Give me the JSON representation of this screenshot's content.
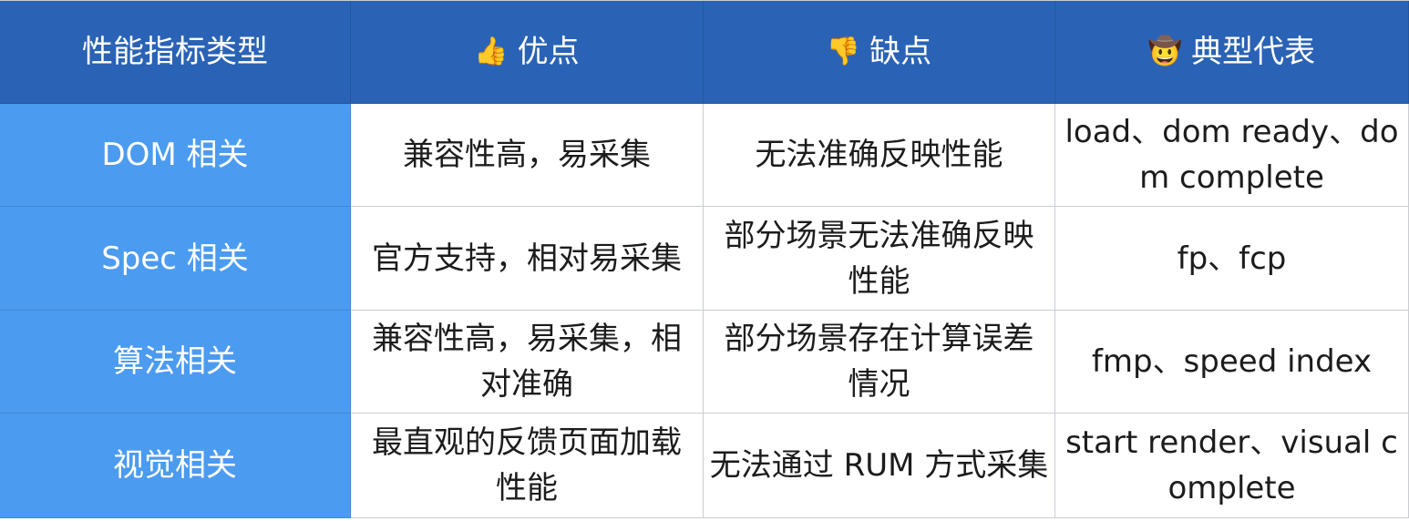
{
  "header": {
    "col1": "性能指标类型",
    "col2": {
      "icon": "👍",
      "label": "优点"
    },
    "col3": {
      "icon": "👎",
      "label": "缺点"
    },
    "col4": {
      "icon": "🤠",
      "label": "典型代表"
    }
  },
  "rows": [
    {
      "type": "DOM 相关",
      "pros": "兼容性高，易采集",
      "cons": "无法准确反映性能",
      "examples": "load、dom ready、dom complete"
    },
    {
      "type": "Spec 相关",
      "pros": "官方支持，相对易采集",
      "cons": "部分场景无法准确反映性能",
      "examples": "fp、fcp"
    },
    {
      "type": "算法相关",
      "pros": "兼容性高，易采集，相对准确",
      "cons": "部分场景存在计算误差情况",
      "examples": "fmp、speed index"
    },
    {
      "type": "视觉相关",
      "pros": "最直观的反馈页面加载性能",
      "cons": "无法通过 RUM 方式采集",
      "examples": "start render、visual complete"
    }
  ],
  "colors": {
    "header_bg": "#2a63b5",
    "row_header_bg": "#4b9bf0",
    "cell_bg": "#ffffff"
  }
}
